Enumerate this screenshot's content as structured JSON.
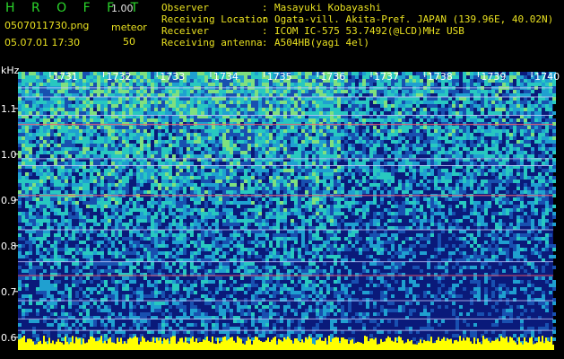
{
  "header": {
    "app_title": "H R O F F T",
    "version": "1.00",
    "filename": "0507011730.png",
    "datetime": "05.07.01 17:30",
    "meteor_label": "meteor",
    "meteor_count": "50"
  },
  "info": [
    {
      "key": "Observer",
      "sep": ":",
      "value": "Masayuki Kobayashi"
    },
    {
      "key": "Receiving Location",
      "sep": ":",
      "value": "Ogata-vill. Akita-Pref. JAPAN (139.96E, 40.02N)"
    },
    {
      "key": "Receiver",
      "sep": ":",
      "value": "ICOM IC-575 53.7492(@LCD)MHz USB"
    },
    {
      "key": "Receiving antenna",
      "sep": ":",
      "value": "A504HB(yagi 4el)"
    }
  ],
  "colors": {
    "title_green": "#2bd62b",
    "label_yellow": "#e8e020",
    "spectrum_low": "#0a1a7a",
    "spectrum_mid": "#1fa0d0",
    "spectrum_high": "#7fe07f",
    "signal_red": "#ff3030",
    "bottom_trace": "#ffff00"
  },
  "chart_data": {
    "type": "heatmap",
    "ylabel": "kHz",
    "y_ticks": [
      "1.1",
      "1.0",
      "0.9",
      "0.8",
      "0.7",
      "0.6"
    ],
    "time_ticks": [
      "1731",
      "1732",
      "1733",
      "1734",
      "1735",
      "1736",
      "1737",
      "1738",
      "1739",
      "1740"
    ],
    "ylim": [
      0.58,
      1.18
    ]
  }
}
